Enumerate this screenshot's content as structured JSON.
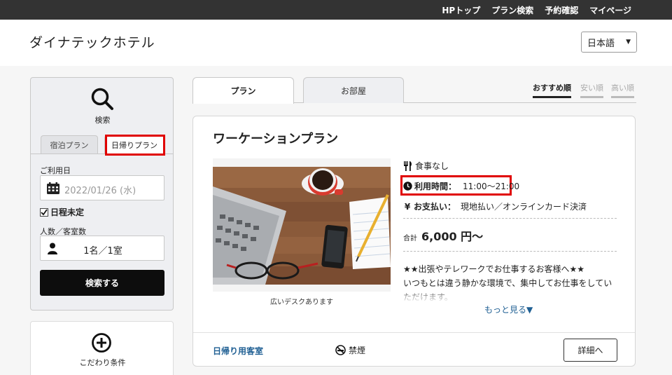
{
  "topnav": {
    "items": [
      "HPトップ",
      "プラン検索",
      "予約確認",
      "マイページ"
    ]
  },
  "header": {
    "hotel_name": "ダイナテックホテル",
    "language": "日本語"
  },
  "search": {
    "title": "検索",
    "tabs": [
      "宿泊プラン",
      "日帰りプラン"
    ],
    "date_label": "ご利用日",
    "date_value": "2022/01/26 (水)",
    "undecided_label": "日程未定",
    "undecided_checked": true,
    "guests_label": "人数／客室数",
    "guests_value": "1名／1室",
    "button": "検索する"
  },
  "conditions": {
    "label": "こだわり条件"
  },
  "main_tabs": [
    "プラン",
    "お部屋"
  ],
  "sort": [
    "おすすめ順",
    "安い順",
    "高い順"
  ],
  "plan": {
    "title": "ワーケーションプラン",
    "photo_caption": "広いデスクあります",
    "meal": "食事なし",
    "time_label": "利用時間：",
    "time_value": "11:00～21:00",
    "payment_label": "お支払い：",
    "payment_value": "現地払い／オンラインカード決済",
    "price_label": "合計",
    "price_value": "6,000 円～",
    "description_1": "★★出張やテレワークでお仕事するお客様へ★★",
    "description_2": "いつもとは違う静かな環境で、集中してお仕事をしていただけます。",
    "more": "もっと見る▼",
    "room_link": "日帰り用客室",
    "nosmoke": "禁煙",
    "detail_button": "詳細へ"
  },
  "colors": {
    "topbar": "#333333",
    "highlight": "#e00000",
    "link": "#1f5f93",
    "button": "#0d0d0d"
  }
}
